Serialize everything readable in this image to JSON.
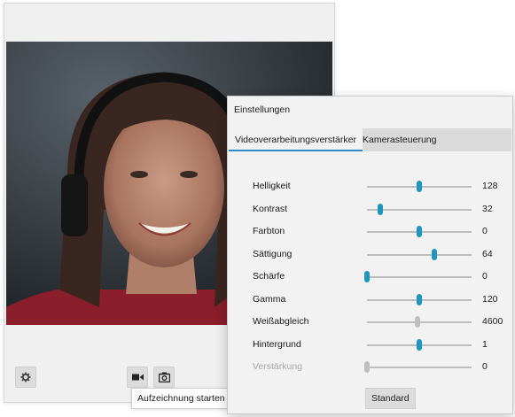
{
  "camera": {
    "record_tooltip": "Aufzeichnung starten",
    "settings_icon": "gear-icon",
    "video_icon": "video-camera-icon",
    "photo_icon": "camera-icon"
  },
  "settings": {
    "title": "Einstellungen",
    "tabs": [
      {
        "label": "Videoverarbeitungsverstärker",
        "active": true
      },
      {
        "label": "Kamerasteuerung",
        "active": false
      }
    ],
    "rows": [
      {
        "label": "Helligkeit",
        "value": "128",
        "level": 0.5,
        "enabled": true
      },
      {
        "label": "Kontrast",
        "value": "32",
        "level": 0.13,
        "enabled": true
      },
      {
        "label": "Farbton",
        "value": "0",
        "level": 0.5,
        "enabled": true
      },
      {
        "label": "Sättigung",
        "value": "64",
        "level": 0.64,
        "enabled": true
      },
      {
        "label": "Schärfe",
        "value": "0",
        "level": 0.0,
        "enabled": true
      },
      {
        "label": "Gamma",
        "value": "120",
        "level": 0.5,
        "enabled": true
      },
      {
        "label": "Weißabgleich",
        "value": "4600",
        "level": 0.48,
        "enabled": true,
        "auto": true
      },
      {
        "label": "Hintergrund",
        "value": "1",
        "level": 0.5,
        "enabled": true
      },
      {
        "label": "Verstärkung",
        "value": "0",
        "level": 0.0,
        "enabled": false
      }
    ],
    "default_button": "Standard",
    "accent_color": "#1f95c0"
  }
}
